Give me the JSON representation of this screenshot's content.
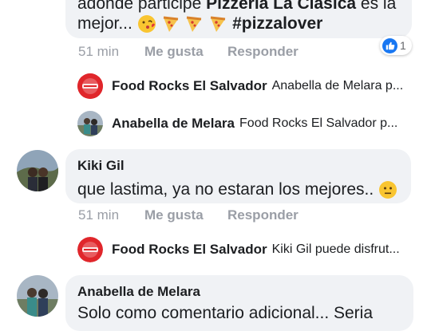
{
  "top_comment": {
    "line1_prefix": "adonde participe ",
    "line1_bold": "Pizzeria La Clásica",
    "line1_suffix": " es la",
    "line2_text": "mejor... ",
    "hashtag": "#pizzalover",
    "reaction_count": "1",
    "time": "51 min",
    "like": "Me gusta",
    "reply": "Responder"
  },
  "replies_top": [
    {
      "author": "Food Rocks El Salvador",
      "preview": "Anabella de Melara p..."
    },
    {
      "author": "Anabella de Melara",
      "preview": "Food Rocks El Salvador  p..."
    }
  ],
  "comment_kiki": {
    "author": "Kiki Gil",
    "text": "que lastima, ya no estaran los mejores.. ",
    "time": "51 min",
    "like": "Me gusta",
    "reply": "Responder"
  },
  "reply_kiki": {
    "author": "Food Rocks El Salvador",
    "preview": "Kiki Gil puede disfrut..."
  },
  "comment_anabella": {
    "author": "Anabella de Melara",
    "text": "Solo como comentario adicional... Seria"
  },
  "colors": {
    "bubble": "#f0f2f5",
    "meta": "#9a9ea6",
    "like_blue": "#1877f2",
    "brand_red": "#e0262b"
  }
}
